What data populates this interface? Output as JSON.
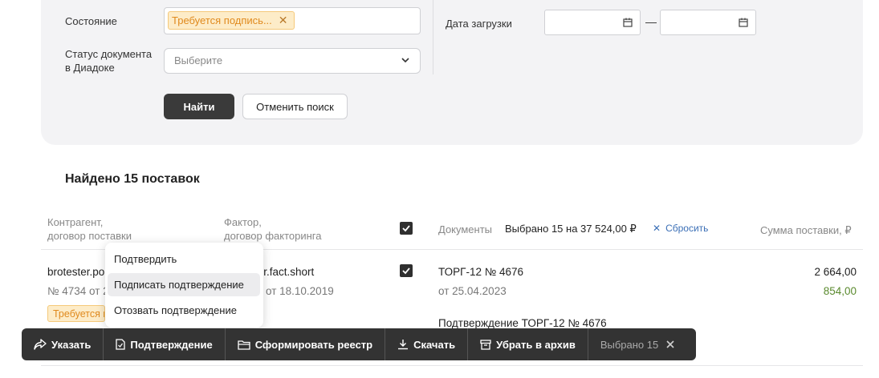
{
  "filters": {
    "state_label": "Состояние",
    "state_tag": "Требуется подпись...",
    "diadoc_label_line1": "Статус документа",
    "diadoc_label_line2": "в Диадоке",
    "diadoc_placeholder": "Выберите",
    "upload_date_label": "Дата загрузки",
    "date_dash": "—",
    "find_button": "Найти",
    "cancel_button": "Отменить поиск"
  },
  "results": {
    "found_text": "Найдено 15 поставок",
    "columns": {
      "counterparty_line1": "Контрагент,",
      "counterparty_line2": "договор поставки",
      "factor_line1": "Фактор,",
      "factor_line2": "договор факторинга",
      "documents": "Документы",
      "selected_summary": "Выбрано 15 на 37 524,00 ₽",
      "reset": "Сбросить",
      "amount": "Сумма поставки, ₽"
    },
    "row": {
      "counterparty": "brotester.po",
      "contract": "№ 4734 от 2",
      "factor": "ter.fact.short",
      "factor_date": "от 18.10.2019",
      "doc_title": "ТОРГ-12 № 4676",
      "doc_date": "от 25.04.2023",
      "doc_confirm": "Подтверждение ТОРГ-12 № 4676",
      "amount": "2 664,00",
      "amount_paid": "854,00",
      "status_tag": "Требуется п"
    }
  },
  "context_menu": {
    "items": [
      {
        "label": "Подтвердить",
        "active": false
      },
      {
        "label": "Подписать подтверждение",
        "active": true
      },
      {
        "label": "Отозвать подтверждение",
        "active": false
      }
    ]
  },
  "toolbar": {
    "specify": "Указать",
    "confirmation": "Подтверждение",
    "form_registry": "Сформировать реестр",
    "download": "Скачать",
    "archive": "Убрать в архив",
    "selected": "Выбрано 15"
  },
  "colors": {
    "accent_tag_bg": "#fdecc8",
    "accent_tag_text": "#e08a1e",
    "toolbar_bg": "#333333",
    "link": "#3b6fb6",
    "paid_green": "#5a8a2e"
  }
}
